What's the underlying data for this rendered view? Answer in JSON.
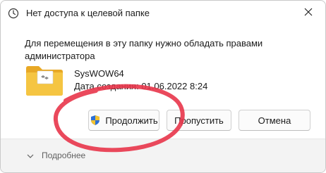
{
  "window": {
    "title": "Нет доступа к целевой папке",
    "close_icon": "close-icon"
  },
  "message": "Для перемещения в эту папку нужно обладать правами администратора",
  "file": {
    "icon": "folder-icon",
    "name": "SysWOW64",
    "date": "Дата создания: 01.06.2022 8:24"
  },
  "buttons": {
    "continue_label": "Продолжить",
    "continue_icon": "uac-shield-icon",
    "skip_label": "Пропустить",
    "cancel_label": "Отмена"
  },
  "footer": {
    "details_label": "Подробнее",
    "details_icon": "chevron-down-icon"
  },
  "colors": {
    "highlight_stroke": "#e8354a",
    "folder": "#f5c542",
    "footer_bg": "#f3f3f3"
  }
}
